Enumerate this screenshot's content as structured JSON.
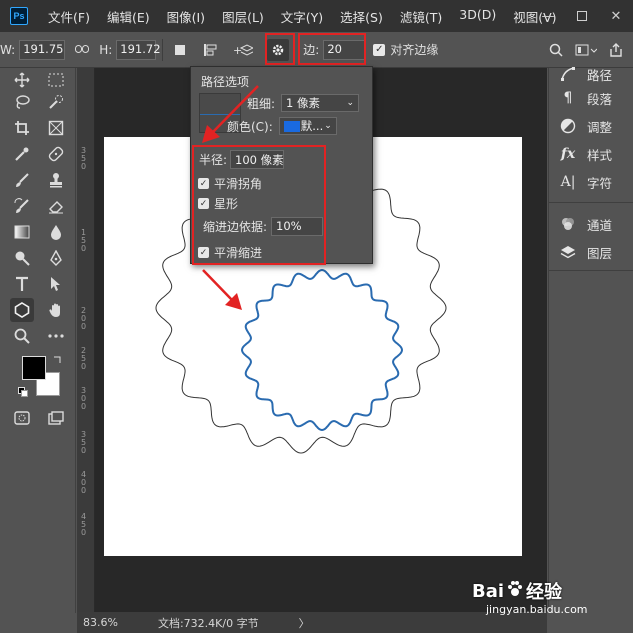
{
  "app": {
    "logo_text": "Ps"
  },
  "menubar": {
    "items": [
      "文件(F)",
      "编辑(E)",
      "图像(I)",
      "图层(L)",
      "文字(Y)",
      "选择(S)",
      "滤镜(T)",
      "3D(D)",
      "视图(V)"
    ],
    "window_controls": [
      "minimize-icon",
      "maximize-icon",
      "close-icon"
    ]
  },
  "options": {
    "w_label": "W:",
    "w_value": "191.75",
    "link_label": "GĐ",
    "h_label": "H:",
    "h_value": "191.72",
    "sides_label": "边:",
    "sides_value": "20",
    "align_edges_label": "对齐边缘",
    "align_edges_checked": true
  },
  "popup": {
    "title": "路径选项",
    "weight_label": "粗细:",
    "weight_value": "1 像素",
    "color_label": "颜色(C):",
    "color_value": "默...",
    "color_swatch": "#1a6ae0",
    "radius_label": "半径:",
    "radius_value": "100 像素",
    "smooth_corners_label": "平滑拐角",
    "star_label": "星形",
    "indent_label": "缩进边依据:",
    "indent_value": "10%",
    "smooth_indents_label": "平滑缩进"
  },
  "right_panel": {
    "items": [
      {
        "label": "路径",
        "icon": "paths-icon"
      },
      {
        "label": "段落",
        "icon": "paragraph-icon"
      },
      {
        "label": "调整",
        "icon": "adjustments-icon"
      },
      {
        "label": "样式",
        "icon": "styles-icon"
      },
      {
        "label": "字符",
        "icon": "character-icon"
      },
      {
        "label": "通道",
        "icon": "channels-icon"
      },
      {
        "label": "图层",
        "icon": "layers-icon"
      }
    ]
  },
  "ruler": {
    "ticks": [
      "3",
      "5",
      "0",
      "1",
      "5",
      "0",
      "2",
      "0",
      "0",
      "2",
      "5",
      "0",
      "3",
      "0",
      "0",
      "3",
      "5",
      "0",
      "4",
      "0",
      "0",
      "4",
      "5",
      "0"
    ]
  },
  "status": {
    "zoom": "83.6%",
    "doc_info": "文档:732.4K/0 字节",
    "arrow": "〉"
  },
  "watermark": {
    "brand": "Bai",
    "brand_suffix": "经验",
    "url": "jingyan.baidu.com"
  },
  "colors": {
    "highlight": "#e22323",
    "path_blue": "#2a6bb0",
    "foreground": "#000000",
    "background": "#ffffff"
  }
}
